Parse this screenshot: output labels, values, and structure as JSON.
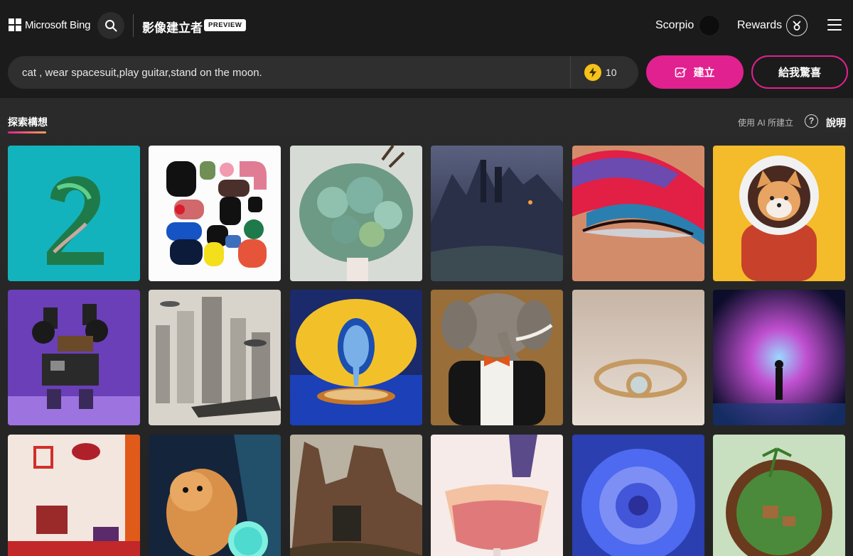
{
  "header": {
    "brand": "Microsoft Bing",
    "app_title": "影像建立者",
    "preview_badge": "PREVIEW",
    "user_name": "Scorpio",
    "rewards_label": "Rewards"
  },
  "prompt": {
    "value": "cat , wear spacesuit,play guitar,stand on the moon.",
    "boosts": "10",
    "create_label": "建立",
    "surprise_label": "給我驚喜"
  },
  "explore": {
    "tab_label": "探索構想",
    "made_with_ai": "使用 AI 所建立",
    "help_label": "說明"
  },
  "gallery": {
    "tiles": [
      "number-two-leaves",
      "abstract-shapes",
      "succulent-bouquet",
      "dark-castle-mountains",
      "glitter-eye-makeup",
      "shiba-astronaut",
      "purple-robot",
      "futuristic-city",
      "surreal-lemon-drop",
      "elephant-in-tuxedo",
      "gold-ring",
      "cosmic-figure",
      "red-room",
      "hamster-crystal-ball",
      "ruins-painting",
      "cocktail-flowers",
      "blue-flower",
      "island-in-coconut"
    ]
  }
}
